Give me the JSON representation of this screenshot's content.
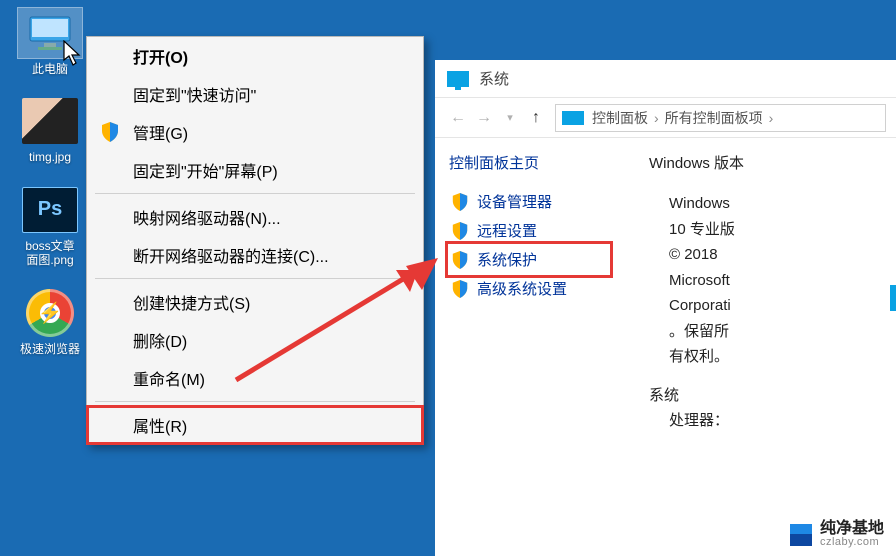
{
  "desktop": {
    "this_pc": "此电脑",
    "img_file": "timg.jpg",
    "ps_file": "boss文章\n面图.png",
    "ps_badge": "Ps",
    "browser": "极速浏览器"
  },
  "context_menu": {
    "open": "打开(O)",
    "pin_quick": "固定到\"快速访问\"",
    "manage": "管理(G)",
    "pin_start": "固定到\"开始\"屏幕(P)",
    "map_drive": "映射网络驱动器(N)...",
    "disconnect_drive": "断开网络驱动器的连接(C)...",
    "create_shortcut": "创建快捷方式(S)",
    "delete": "删除(D)",
    "rename": "重命名(M)",
    "properties": "属性(R)"
  },
  "system_window": {
    "title": "系统",
    "breadcrumb": {
      "control_panel": "控制面板",
      "all_items": "所有控制面板项"
    },
    "left": {
      "cp_home": "控制面板主页",
      "device_manager": "设备管理器",
      "remote_settings": "远程设置",
      "system_protection": "系统保护",
      "advanced": "高级系统设置"
    },
    "right": {
      "windows_edition_heading": "Windows 版本",
      "edition_line1": "Windows",
      "edition_line2": "10 专业版",
      "copyright1": "© 2018",
      "copyright2": "Microsoft",
      "copyright3": "Corporati",
      "copyright4": "。保留所",
      "copyright5": "有权利。",
      "system_heading": "系统",
      "processor_label": "处理器："
    }
  },
  "watermark": {
    "name": "纯净基地",
    "url": "czlaby.com"
  }
}
